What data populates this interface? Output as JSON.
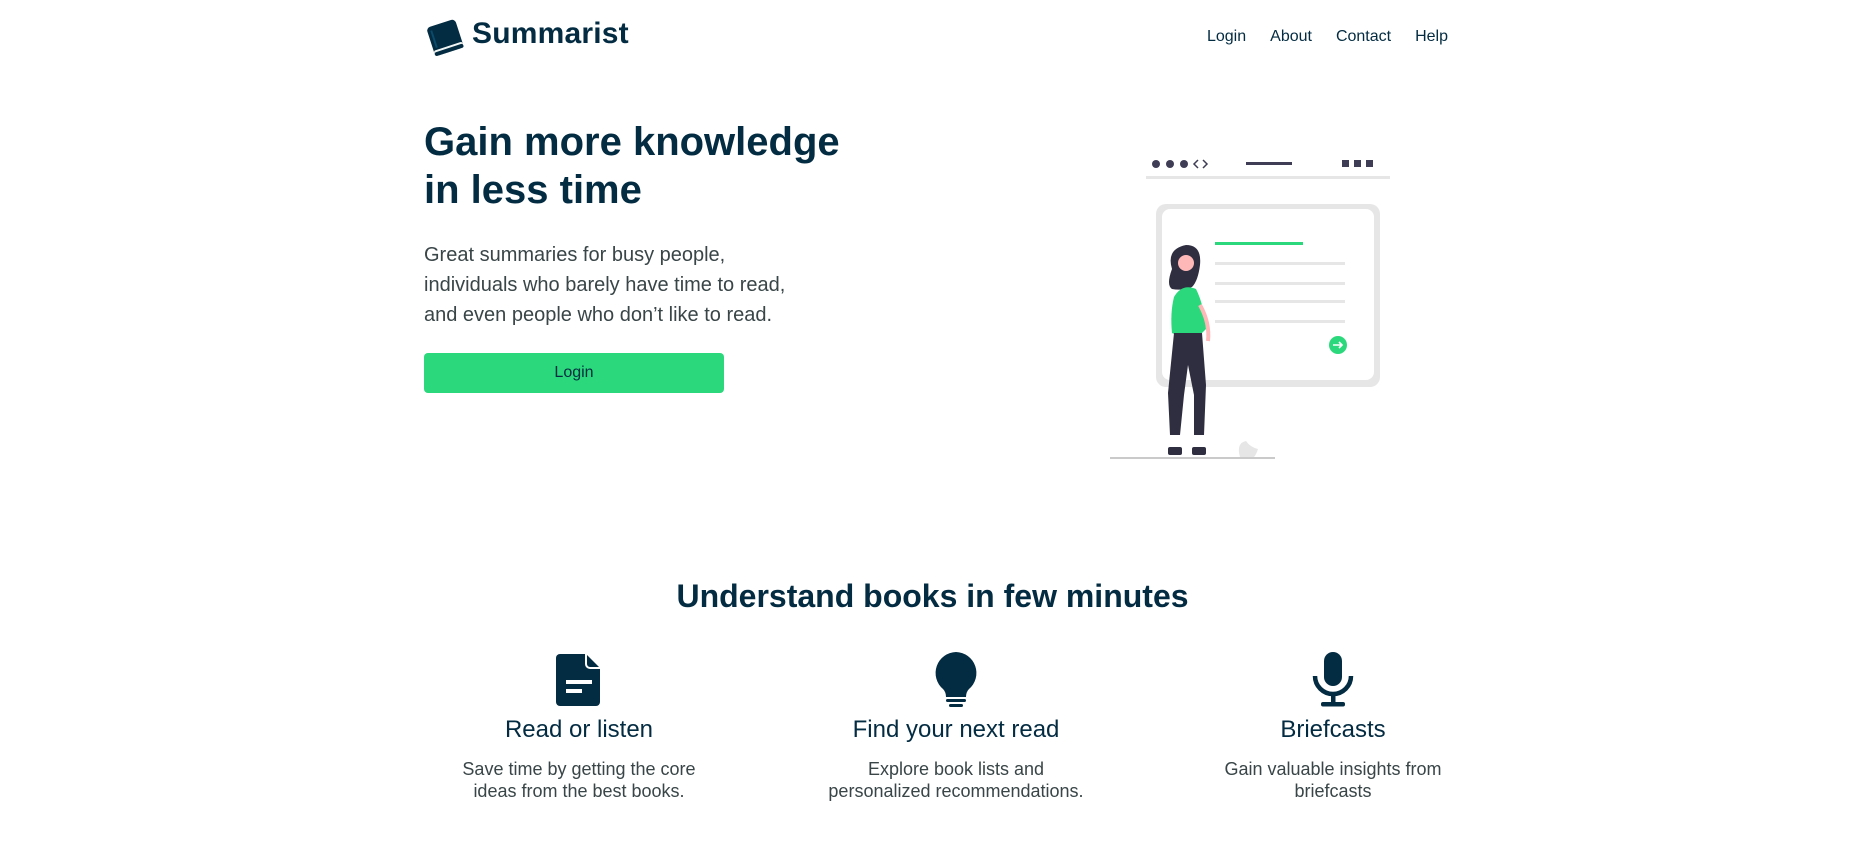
{
  "brand": {
    "name": "Summarist",
    "accent": "#2bd97c",
    "primary": "#032b41",
    "text_muted": "#394547"
  },
  "nav": {
    "links": [
      "Login",
      "About",
      "Contact",
      "Help"
    ]
  },
  "hero": {
    "title": "Gain more knowledge in less time",
    "subtitle": "Great summaries for busy people, individuals who barely have time to read, and even people who don’t like to read.",
    "button_label": "Login",
    "illustration": "woman-reading-screen-illustration"
  },
  "features": {
    "title": "Understand books in few minutes",
    "items": [
      {
        "icon": "document-icon",
        "title": "Read or listen",
        "description": "Save time by getting the core ideas from the best books."
      },
      {
        "icon": "lightbulb-icon",
        "title": "Find your next read",
        "description": "Explore book lists and personalized recommendations."
      },
      {
        "icon": "microphone-icon",
        "title": "Briefcasts",
        "description": "Gain valuable insights from briefcasts"
      }
    ]
  }
}
